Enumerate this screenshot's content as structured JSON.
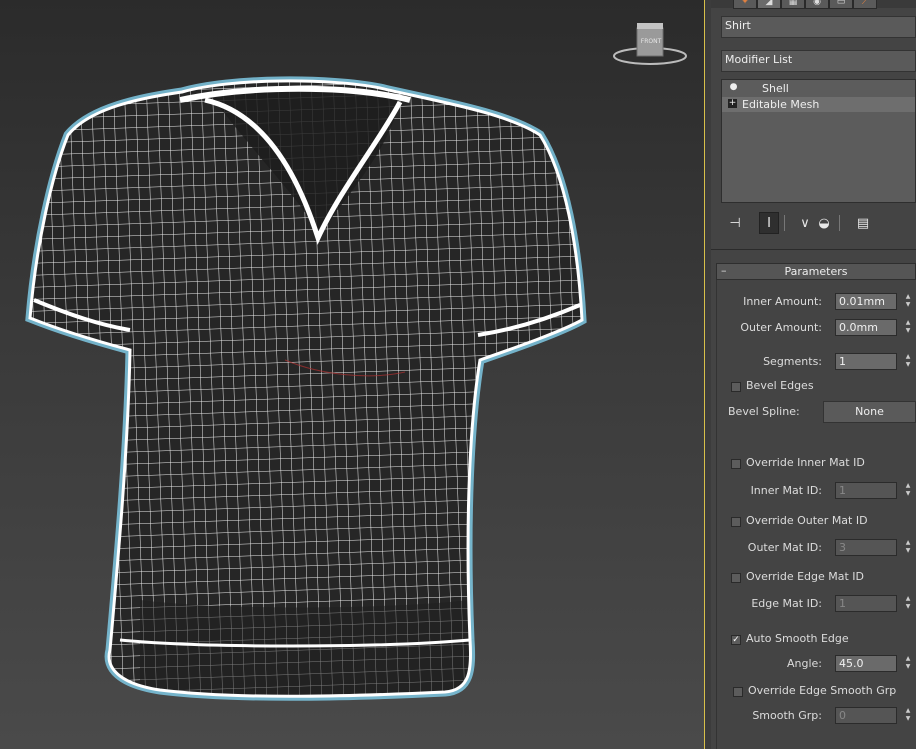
{
  "viewport": {
    "viewcube_label": "FRONT"
  },
  "panel": {
    "tab_icons": [
      "create-icon",
      "modify-icon",
      "hierarchy-icon",
      "motion-icon",
      "display-icon",
      "utilities-icon"
    ],
    "object_name": "Shirt",
    "modifier_list": "Modifier List",
    "stack": [
      {
        "label": "Shell",
        "icon": "lightbulb-icon",
        "selected": false
      },
      {
        "label": "Editable Mesh",
        "icon": "plus-box-icon",
        "selected": true
      }
    ],
    "parameters": {
      "title": "Parameters",
      "inner_amount_label": "Inner Amount:",
      "inner_amount": "0.01mm",
      "outer_amount_label": "Outer Amount:",
      "outer_amount": "0.0mm",
      "segments_label": "Segments:",
      "segments": "1",
      "bevel_edges_label": "Bevel Edges",
      "bevel_edges": false,
      "bevel_spline_label": "Bevel Spline:",
      "bevel_spline_value": "None",
      "override_inner_label": "Override Inner Mat ID",
      "override_inner": false,
      "inner_mat_id_label": "Inner Mat ID:",
      "inner_mat_id": "1",
      "override_outer_label": "Override Outer Mat ID",
      "override_outer": false,
      "outer_mat_id_label": "Outer Mat ID:",
      "outer_mat_id": "3",
      "override_edge_label": "Override Edge Mat ID",
      "override_edge": false,
      "edge_mat_id_label": "Edge Mat ID:",
      "edge_mat_id": "1",
      "auto_smooth_label": "Auto Smooth Edge",
      "auto_smooth": true,
      "angle_label": "Angle:",
      "angle": "45.0",
      "override_smooth_label": "Override Edge Smooth Grp",
      "override_smooth": false,
      "smooth_grp_label": "Smooth Grp:",
      "smooth_grp": "0"
    }
  }
}
